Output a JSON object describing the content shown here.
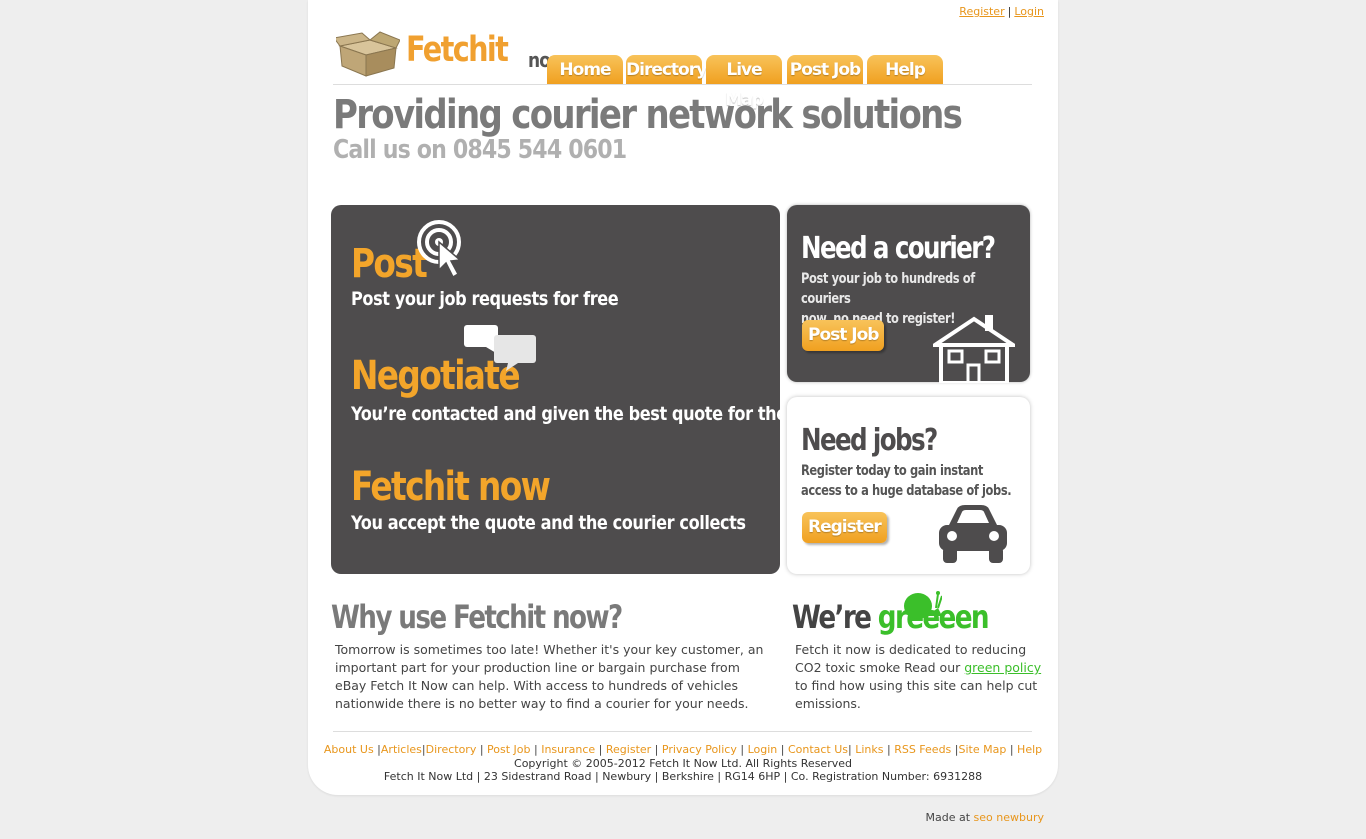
{
  "top_links": {
    "register": "Register",
    "separator": "|",
    "login": "Login"
  },
  "logo": {
    "brand": "Fetchit",
    "suffix": "now"
  },
  "nav": [
    {
      "label": "Home"
    },
    {
      "label": "Directory"
    },
    {
      "label": "Live Map"
    },
    {
      "label": "Post Job"
    },
    {
      "label": "Help"
    }
  ],
  "hero": {
    "title": "Providing courier network solutions",
    "subtitle": "Call us on 0845 544 0601"
  },
  "steps": [
    {
      "title": "Post",
      "desc": "Post your job requests for free"
    },
    {
      "title": "Negotiate",
      "desc": "You’re contacted and given the best quote for the job"
    },
    {
      "title": "Fetchit now",
      "desc": "You accept the quote and the courier collects"
    }
  ],
  "courier_box": {
    "title": "Need a courier?",
    "line1": "Post your job to hundreds of couriers",
    "line2": "now, no need to register!",
    "button": "Post Job"
  },
  "jobs_box": {
    "title": "Need jobs?",
    "line1": "Register today to gain instant",
    "line2": "access to a huge database of jobs.",
    "button": "Register"
  },
  "why": {
    "title": "Why use Fetchit now?",
    "text": "Tomorrow is sometimes too late! Whether it's your key customer, an important part for your production line or bargain purchase from eBay Fetch It Now can help. With access to hundreds of vehicles nationwide there is no better way to find a courier for your needs."
  },
  "green": {
    "title_prefix": "We’re",
    "title_green": "greeeen",
    "text_before": "Fetch it now is dedicated to reducing CO2 toxic smoke Read our",
    "link": "green policy",
    "text_after": "to find how using this site can help cut emissions."
  },
  "footer": {
    "links": [
      "About Us",
      "Articles",
      "Directory",
      "Post Job",
      "Insurance",
      "Register",
      "Privacy Policy",
      "Login",
      "Contact Us",
      "Links",
      "RSS Feeds",
      "Site Map",
      "Help"
    ],
    "separators": [
      " |",
      "|",
      " | ",
      " | ",
      " | ",
      " | ",
      " | ",
      " | ",
      "| ",
      " | ",
      " |",
      " | "
    ],
    "copyright": "Copyright © 2005-2012 Fetch It Now Ltd. All Rights Reserved",
    "address": "Fetch It Now Ltd | 23 Sidestrand Road  | Newbury | Berkshire | RG14 6HP | Co. Registration Number: 6931288"
  },
  "made_at": {
    "prefix": "Made at",
    "link": "seo newbury"
  },
  "colors": {
    "accent_orange": "#f0a020",
    "dark_panel": "#4e4c4d",
    "green": "#3bbf2a",
    "page_bg": "#eeeeee"
  }
}
